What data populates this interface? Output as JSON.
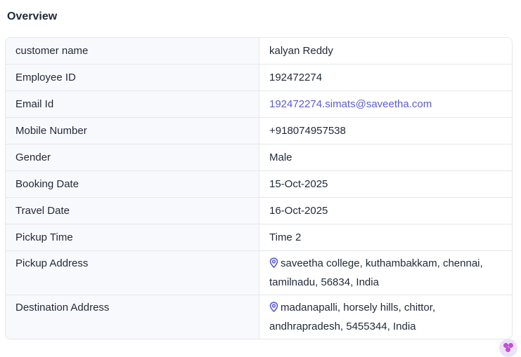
{
  "header": {
    "title": "Overview"
  },
  "details": [
    {
      "label": "customer name",
      "value": "kalyan Reddy"
    },
    {
      "label": "Employee ID",
      "value": "192472274"
    },
    {
      "label": "Email Id",
      "value": "192472274.simats@saveetha.com"
    },
    {
      "label": "Mobile Number",
      "value": "+918074957538"
    },
    {
      "label": "Gender",
      "value": "Male"
    },
    {
      "label": "Booking Date",
      "value": "15-Oct-2025"
    },
    {
      "label": "Travel Date",
      "value": "16-Oct-2025"
    },
    {
      "label": "Pickup Time",
      "value": "Time 2"
    },
    {
      "label": "Pickup Address",
      "value": "saveetha college, kuthambakkam, chennai, tamilnadu, 56834, India",
      "icon": "map-pin-icon"
    },
    {
      "label": "Destination Address",
      "value": "madanapalli, horsely hills, chittor, andhrapradesh, 5455344, India",
      "icon": "map-pin-icon"
    }
  ],
  "colors": {
    "link": "#5b5bd6",
    "label_bg": "#f8f9fc",
    "border": "#e5e7eb",
    "icon": "#5b5bd6"
  }
}
